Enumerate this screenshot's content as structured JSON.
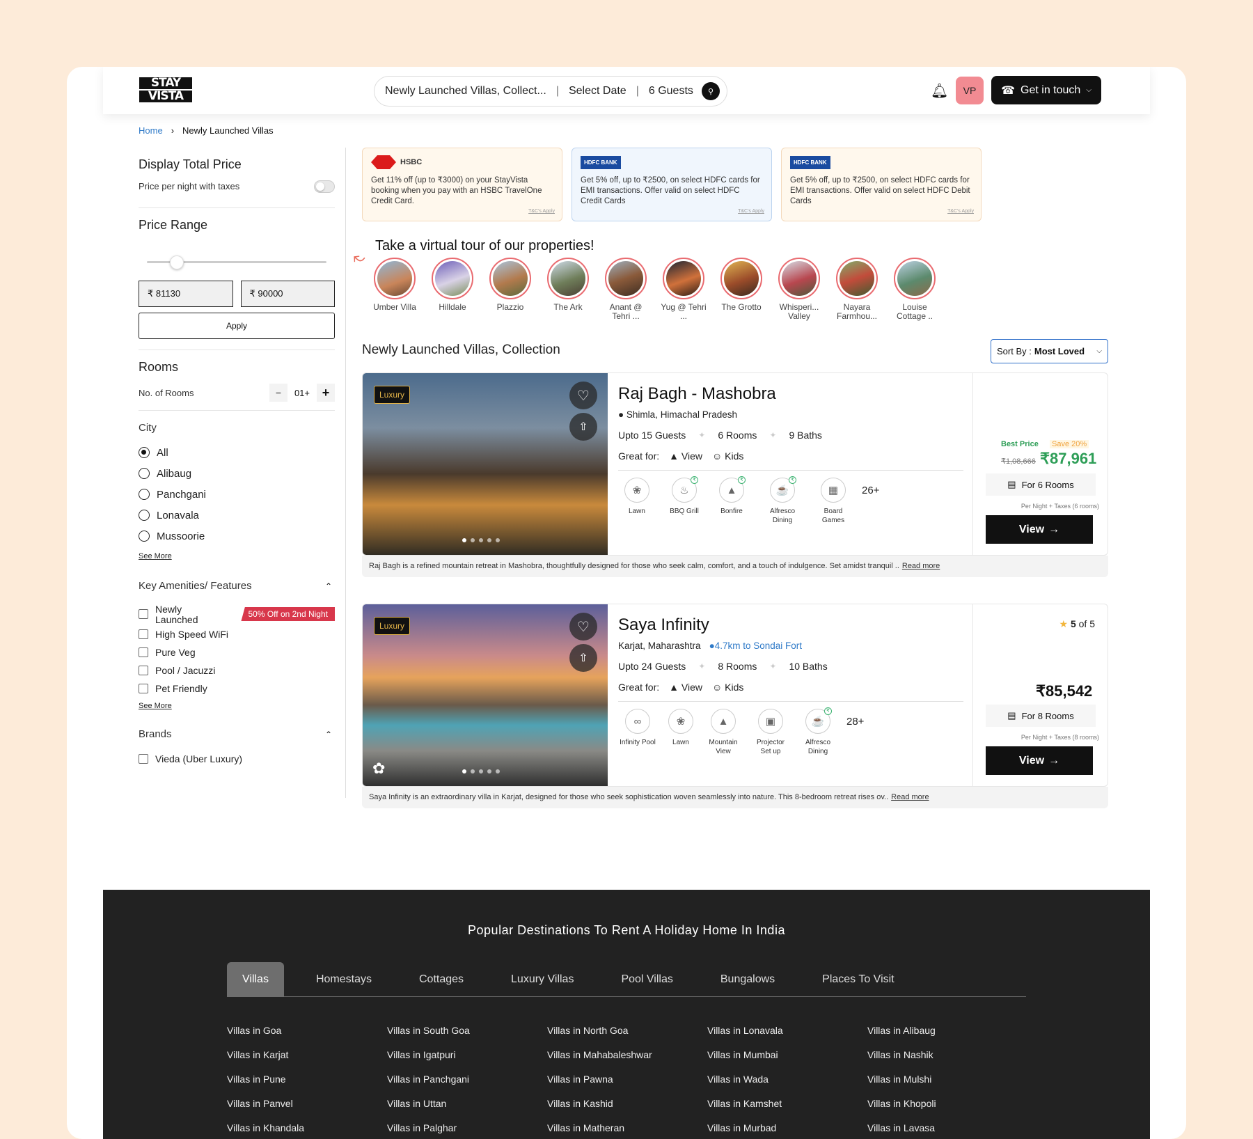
{
  "header": {
    "logo": [
      "STAY",
      "VISTA"
    ],
    "search_location": "Newly Launched Villas, Collect...",
    "search_date": "Select Date",
    "search_guests": "6 Guests",
    "avatar": "VP",
    "cta": "Get in touch"
  },
  "breadcrumb": {
    "home": "Home",
    "current": "Newly Launched Villas"
  },
  "sidebar": {
    "display_total_price": "Display Total Price",
    "price_per_night": "Price per night with taxes",
    "price_range": "Price Range",
    "price_min": "₹ 81130",
    "price_max": "₹ 90000",
    "apply": "Apply",
    "rooms_title": "Rooms",
    "rooms_label": "No. of Rooms",
    "rooms_value": "01+",
    "city_title": "City",
    "cities": [
      "All",
      "Alibaug",
      "Panchgani",
      "Lonavala",
      "Mussoorie"
    ],
    "see_more": "See More",
    "amenities_title": "Key Amenities/ Features",
    "amenities": [
      "Newly Launched",
      "High Speed WiFi",
      "Pure Veg",
      "Pool / Jacuzzi",
      "Pet Friendly"
    ],
    "amenity_tag": "50% Off on 2nd Night",
    "brands_title": "Brands",
    "brands": [
      "Vieda (Uber Luxury)"
    ]
  },
  "offers": [
    {
      "brand": "HSBC",
      "text": "Get 11% off (up to ₹3000) on your StayVista booking when you pay with an HSBC TravelOne Credit Card.",
      "tc": "T&C's Apply"
    },
    {
      "brand": "HDFC BANK",
      "text": "Get 5% off, up to ₹2500, on select HDFC cards for EMI transactions. Offer valid on select HDFC Credit Cards",
      "tc": "T&C's Apply"
    },
    {
      "brand": "HDFC BANK",
      "text": "Get 5% off, up to ₹2500, on select HDFC cards for EMI transactions. Offer valid on select HDFC Debit Cards",
      "tc": "T&C's Apply"
    }
  ],
  "tour": {
    "title": "Take a virtual tour of our properties!",
    "items": [
      "Umber Villa",
      "Hilldale",
      "Plazzio",
      "The Ark",
      "Anant @ Tehri ...",
      "Yug @ Tehri ...",
      "The Grotto",
      "Whisperi... Valley",
      "Nayara Farmhou...",
      "Louise Cottage .."
    ]
  },
  "collection": {
    "title": "Newly Launched Villas, Collection",
    "sort_label": "Sort By :",
    "sort_value": "Most Loved"
  },
  "villas": [
    {
      "badge": "Luxury",
      "name": "Raj Bagh - Mashobra",
      "location": "Shimla, Himachal Pradesh",
      "guests": "Upto 15 Guests",
      "rooms": "6 Rooms",
      "baths": "9 Baths",
      "great_for_label": "Great for:",
      "great_for": [
        "View",
        "Kids"
      ],
      "amenities": [
        "Lawn",
        "BBQ Grill",
        "Bonfire",
        "Alfresco Dining",
        "Board Games"
      ],
      "more": "26+",
      "best_price": "Best Price",
      "save": "Save 20%",
      "old_price": "₹1,08,666",
      "price": "₹87,961",
      "for_rooms": "For 6 Rooms",
      "per_night": "Per Night + Taxes (6 rooms)",
      "view": "View",
      "description": "Raj Bagh is a refined mountain retreat in Mashobra, thoughtfully designed for those who seek calm, comfort, and a touch of indulgence. Set amidst tranquil ..",
      "read_more": "Read more"
    },
    {
      "badge": "Luxury",
      "name": "Saya Infinity",
      "location": "Karjat, Maharashtra",
      "distance": "4.7km to Sondai Fort",
      "rating": "5",
      "rating_of": "of 5",
      "guests": "Upto 24 Guests",
      "rooms": "8 Rooms",
      "baths": "10 Baths",
      "great_for_label": "Great for:",
      "great_for": [
        "View",
        "Kids"
      ],
      "amenities": [
        "Infinity Pool",
        "Lawn",
        "Mountain View",
        "Projector Set up",
        "Alfresco Dining"
      ],
      "more": "28+",
      "price": "₹85,542",
      "for_rooms": "For 8 Rooms",
      "per_night": "Per Night + Taxes (8 rooms)",
      "view": "View",
      "description": "Saya Infinity is an extraordinary villa in Karjat, designed for those who seek sophistication woven seamlessly into nature. This 8-bedroom retreat rises ov..",
      "read_more": "Read more"
    }
  ],
  "footer": {
    "title": "Popular Destinations To Rent A Holiday Home In India",
    "tabs": [
      "Villas",
      "Homestays",
      "Cottages",
      "Luxury Villas",
      "Pool Villas",
      "Bungalows",
      "Places To Visit"
    ],
    "links": [
      "Villas in Goa",
      "Villas in South Goa",
      "Villas in North Goa",
      "Villas in Lonavala",
      "Villas in Alibaug",
      "Villas in Karjat",
      "Villas in Igatpuri",
      "Villas in Mahabaleshwar",
      "Villas in Mumbai",
      "Villas in Nashik",
      "Villas in Pune",
      "Villas in Panchgani",
      "Villas in Pawna",
      "Villas in Wada",
      "Villas in Mulshi",
      "Villas in Panvel",
      "Villas in Uttan",
      "Villas in Kashid",
      "Villas in Kamshet",
      "Villas in Khopoli",
      "Villas in Khandala",
      "Villas in Palghar",
      "Villas in Matheran",
      "Villas in Murbad",
      "Villas in Lavasa"
    ]
  },
  "colors": {
    "accent_green": "#2e9e57",
    "brand_red": "#d8374b",
    "link_blue": "#2f7ac8",
    "footer_bg": "#222222",
    "page_bg": "#fdebd9"
  }
}
